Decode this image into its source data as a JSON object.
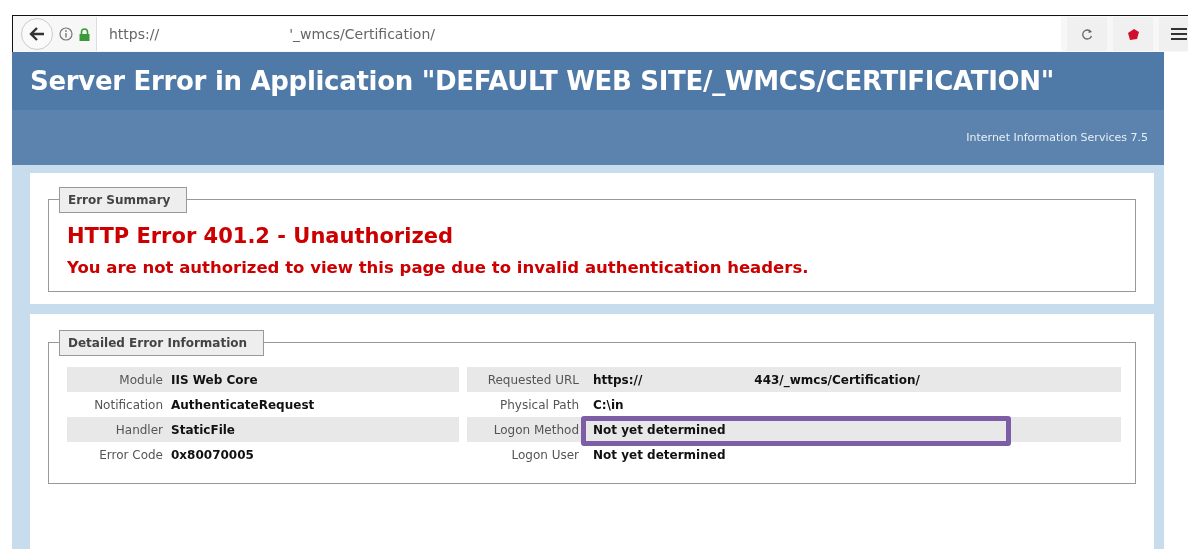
{
  "browser": {
    "url_scheme": "https://",
    "url_path": "'_wmcs/Certification/"
  },
  "header": {
    "title": "Server Error in Application \"DEFAULT WEB SITE/_WMCS/CERTIFICATION\"",
    "subtitle": "Internet Information Services 7.5"
  },
  "summary": {
    "legend": "Error Summary",
    "heading": "HTTP Error 401.2 - Unauthorized",
    "message": "You are not authorized to view this page due to invalid authentication headers."
  },
  "details": {
    "legend": "Detailed Error Information",
    "left": [
      {
        "label": "Module",
        "value": "IIS Web Core"
      },
      {
        "label": "Notification",
        "value": "AuthenticateRequest"
      },
      {
        "label": "Handler",
        "value": "StaticFile"
      },
      {
        "label": "Error Code",
        "value": "0x80070005"
      }
    ],
    "right": [
      {
        "label": "Requested URL",
        "value": "https://",
        "value_2": "443/_wmcs/Certification/"
      },
      {
        "label": "Physical Path",
        "value": "C:\\in"
      },
      {
        "label": "Logon Method",
        "value": "Not yet determined"
      },
      {
        "label": "Logon User",
        "value": "Not yet determined"
      }
    ]
  },
  "highlight": {
    "shown": true
  }
}
